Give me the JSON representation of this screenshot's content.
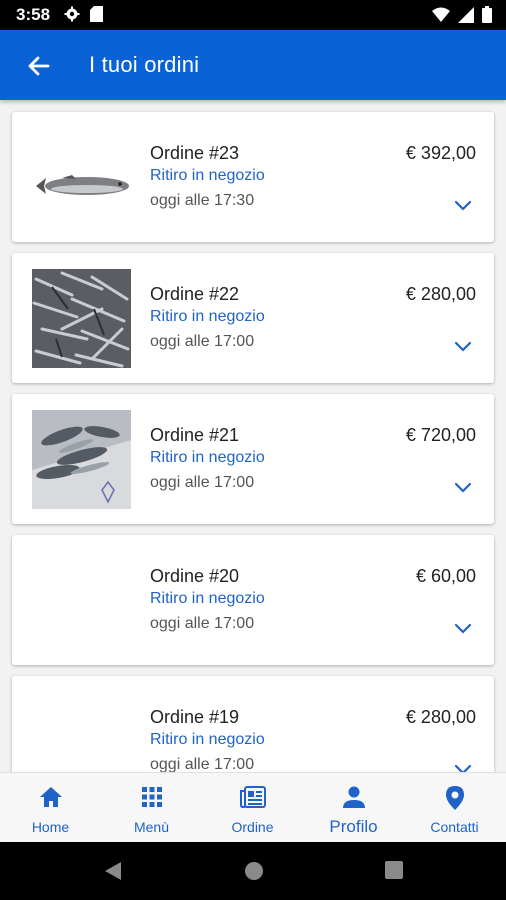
{
  "status_bar": {
    "time": "3:58"
  },
  "app_bar": {
    "title": "I tuoi ordini"
  },
  "orders": [
    {
      "label": "Ordine #23",
      "price": "€ 392,00",
      "pickup": "Ritiro in negozio",
      "time": "oggi alle 17:30"
    },
    {
      "label": "Ordine #22",
      "price": "€ 280,00",
      "pickup": "Ritiro in negozio",
      "time": "oggi alle 17:00"
    },
    {
      "label": "Ordine #21",
      "price": "€ 720,00",
      "pickup": "Ritiro in negozio",
      "time": "oggi alle 17:00"
    },
    {
      "label": "Ordine #20",
      "price": "€ 60,00",
      "pickup": "Ritiro in negozio",
      "time": "oggi alle 17:00"
    },
    {
      "label": "Ordine #19",
      "price": "€ 280,00",
      "pickup": "Ritiro in negozio",
      "time": "oggi alle 17:00"
    }
  ],
  "bottom_nav": {
    "items": [
      {
        "label": "Home",
        "icon": "home-icon"
      },
      {
        "label": "Menù",
        "icon": "grid-icon"
      },
      {
        "label": "Ordine",
        "icon": "order-icon"
      },
      {
        "label": "Profilo",
        "icon": "person-icon"
      },
      {
        "label": "Contatti",
        "icon": "location-pin-icon"
      }
    ]
  },
  "colors": {
    "primary": "#0a63d6",
    "accent_text": "#1f63c9"
  }
}
